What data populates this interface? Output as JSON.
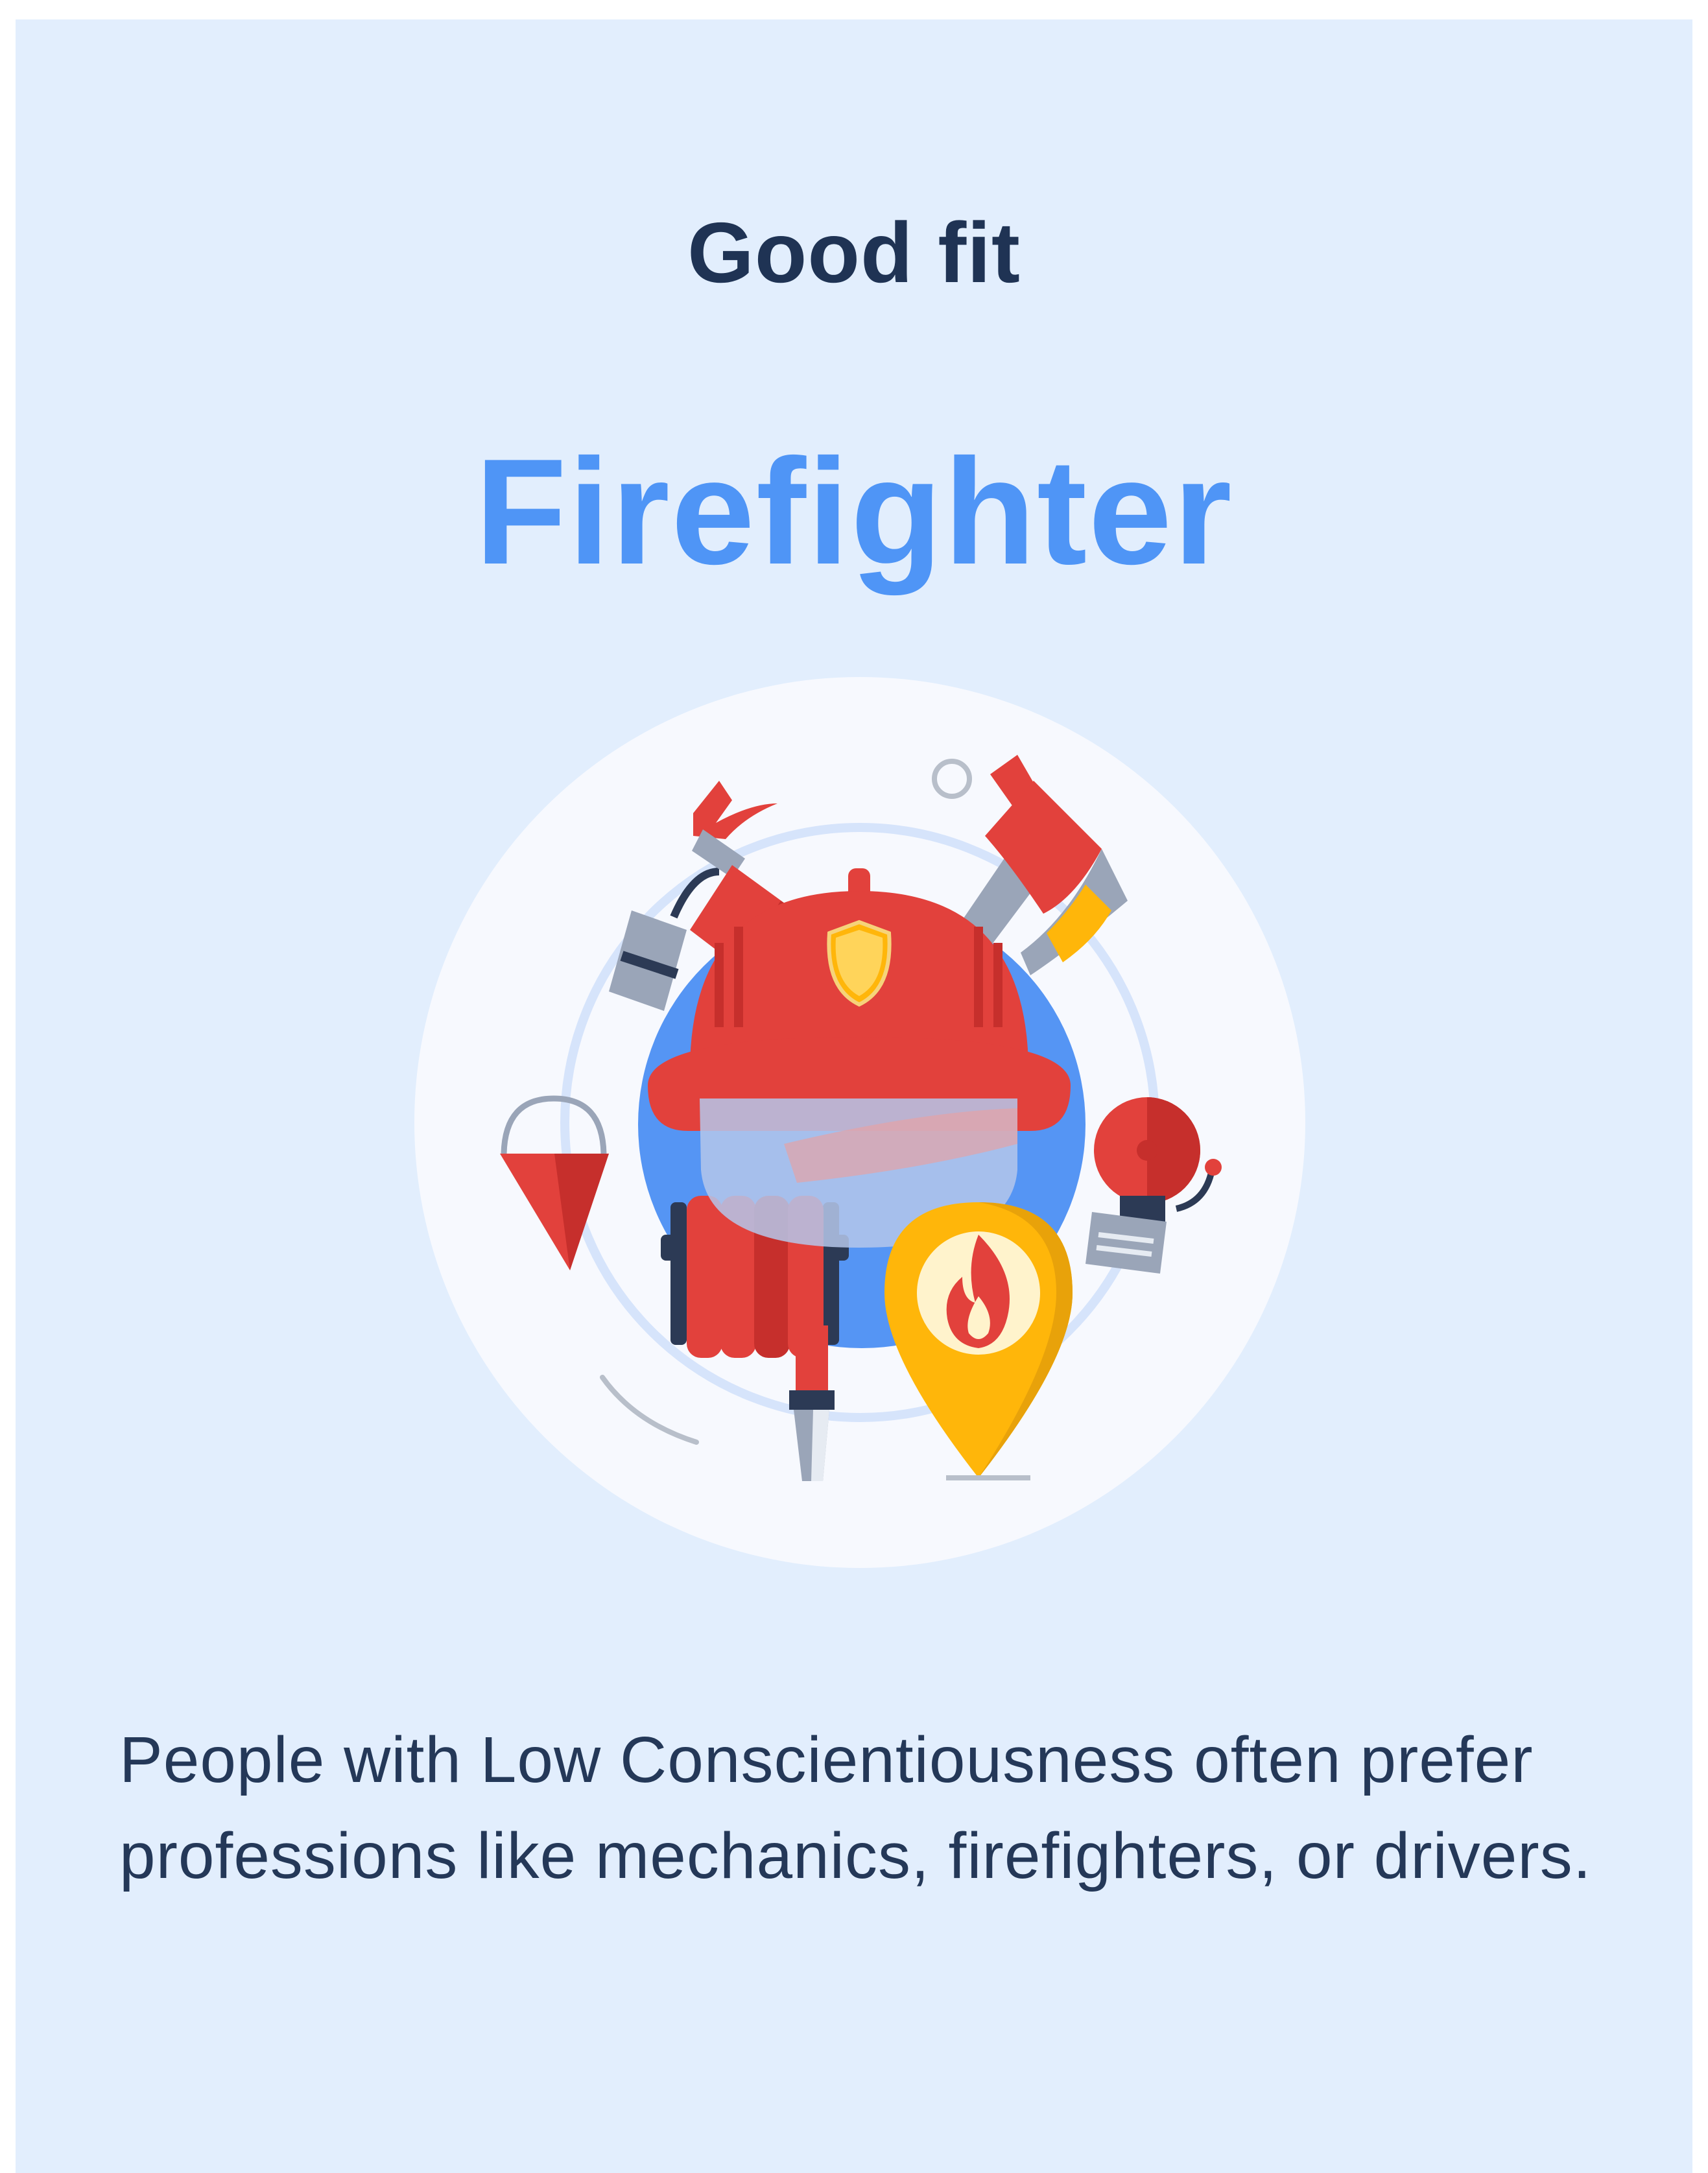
{
  "card": {
    "eyebrow": "Good fit",
    "title": "Firefighter",
    "description": "People with Low Conscientiousness often prefer professions like mechanics, firefighters, or drivers."
  },
  "illustration": {
    "icon": "firefighter-equipment-illustration",
    "colors": {
      "background_circle": "#f7f9fe",
      "inner_circle": "#5595f4",
      "red": "#e2413c",
      "dark_red": "#c62f2c",
      "gold": "#ffb60a",
      "steel": "#9aa5b8",
      "navy": "#2c3a55"
    }
  },
  "colors": {
    "card_background": "#e2eefd",
    "heading": "#1f3354",
    "accent": "#4f95f6",
    "body_text": "#243858"
  }
}
